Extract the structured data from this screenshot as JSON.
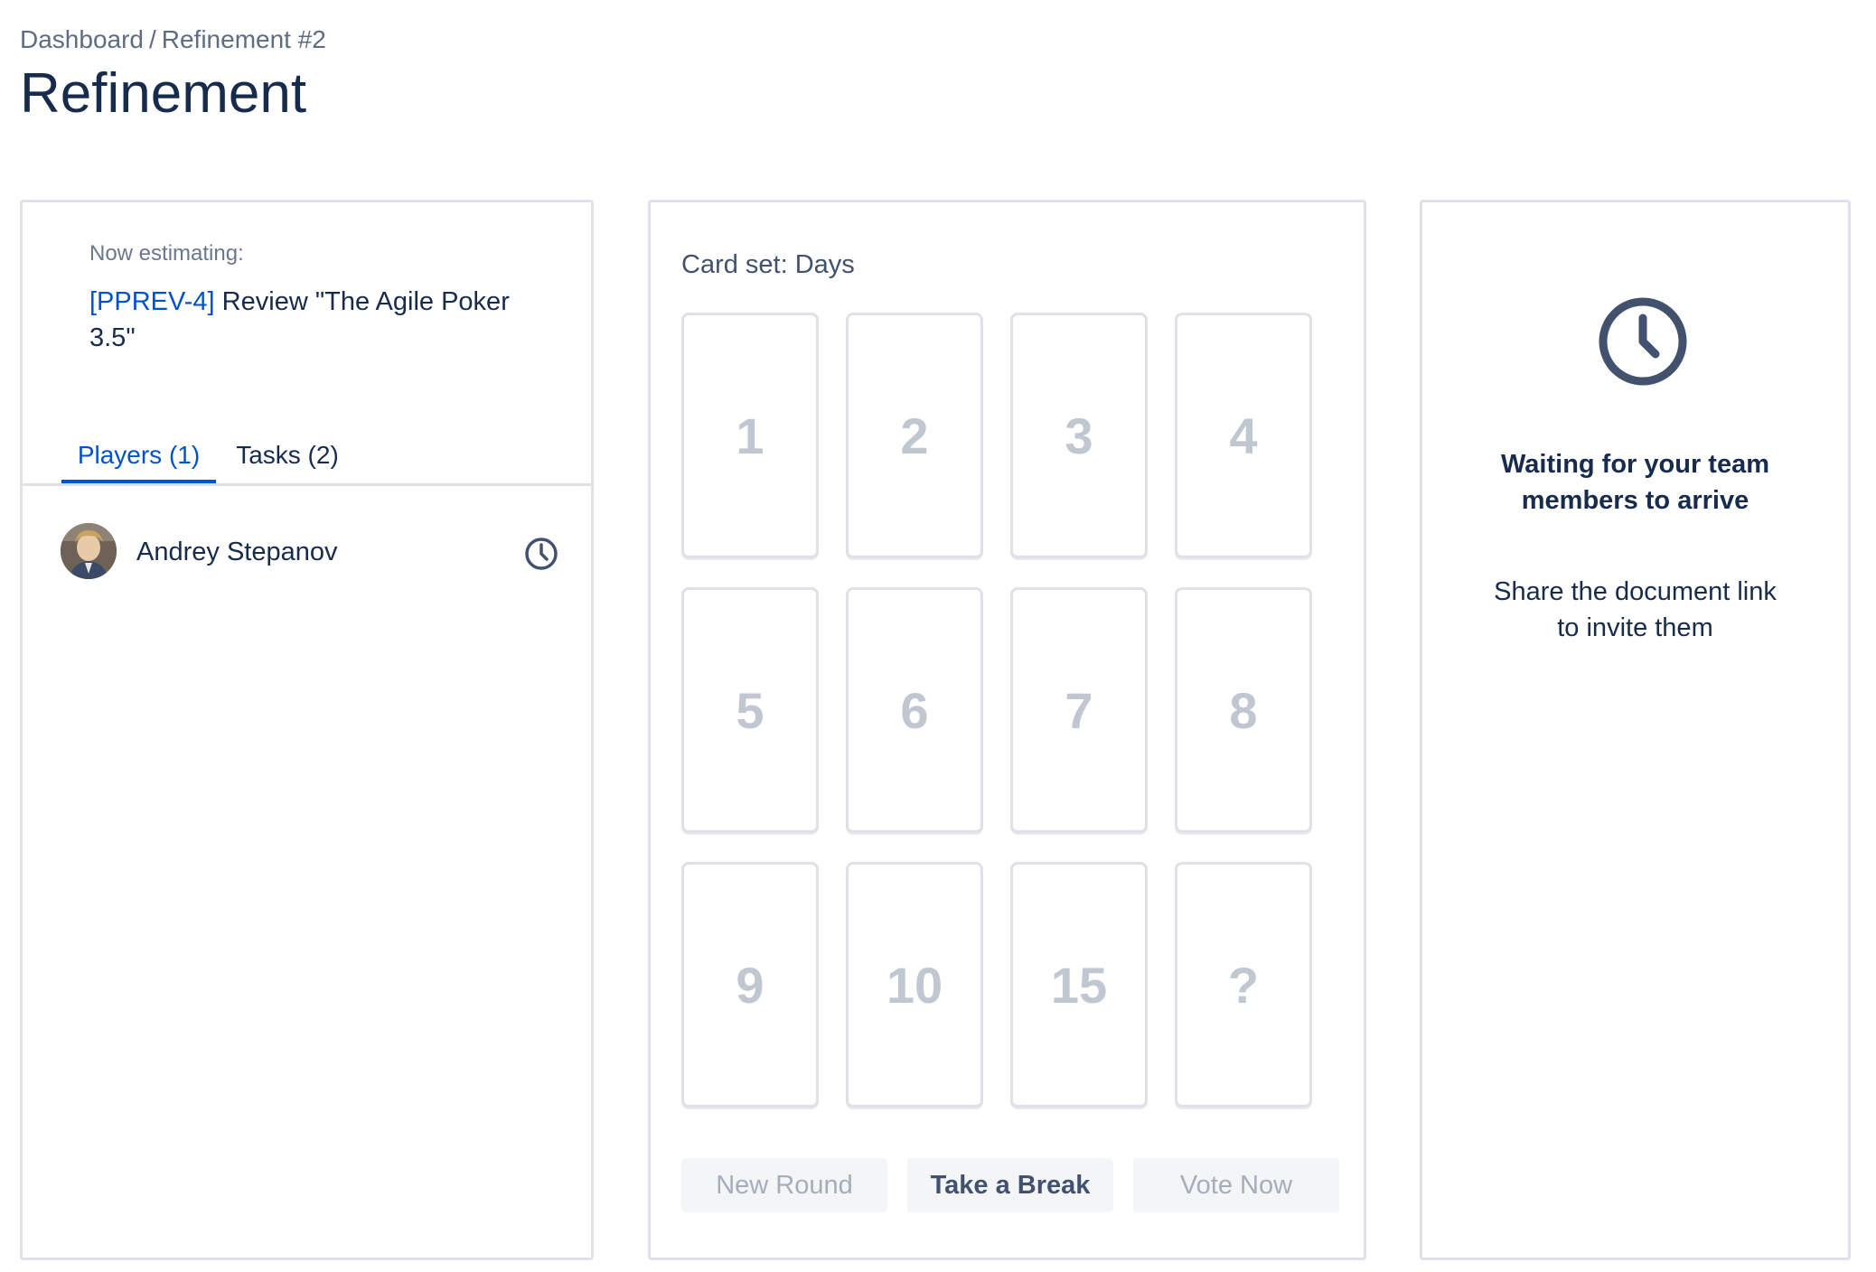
{
  "breadcrumb": {
    "dashboard": "Dashboard",
    "separator": "/",
    "current": "Refinement #2"
  },
  "page_title": "Refinement",
  "estimation": {
    "label": "Now estimating:",
    "issue_key": "[PPREV-4]",
    "issue_summary": " Review \"The Agile Poker 3.5\""
  },
  "tabs": [
    {
      "label": "Players (1)",
      "active": true
    },
    {
      "label": "Tasks (2)",
      "active": false
    }
  ],
  "players": [
    {
      "name": "Andrey Stepanov",
      "status_icon": "clock-icon"
    }
  ],
  "card_set_label": "Card set: Days",
  "cards": [
    "1",
    "2",
    "3",
    "4",
    "5",
    "6",
    "7",
    "8",
    "9",
    "10",
    "15",
    "?"
  ],
  "buttons": {
    "new_round": "New Round",
    "take_break": "Take a Break",
    "vote_now": "Vote Now"
  },
  "waiting": {
    "title": "Waiting for your team members to arrive",
    "subtitle": "Share the document link to invite them",
    "icon": "clock-icon"
  },
  "colors": {
    "accent": "#0052cc",
    "text": "#172b4d",
    "border": "#dfe1e6",
    "muted": "#c1c7d0",
    "icon": "#42526e"
  }
}
